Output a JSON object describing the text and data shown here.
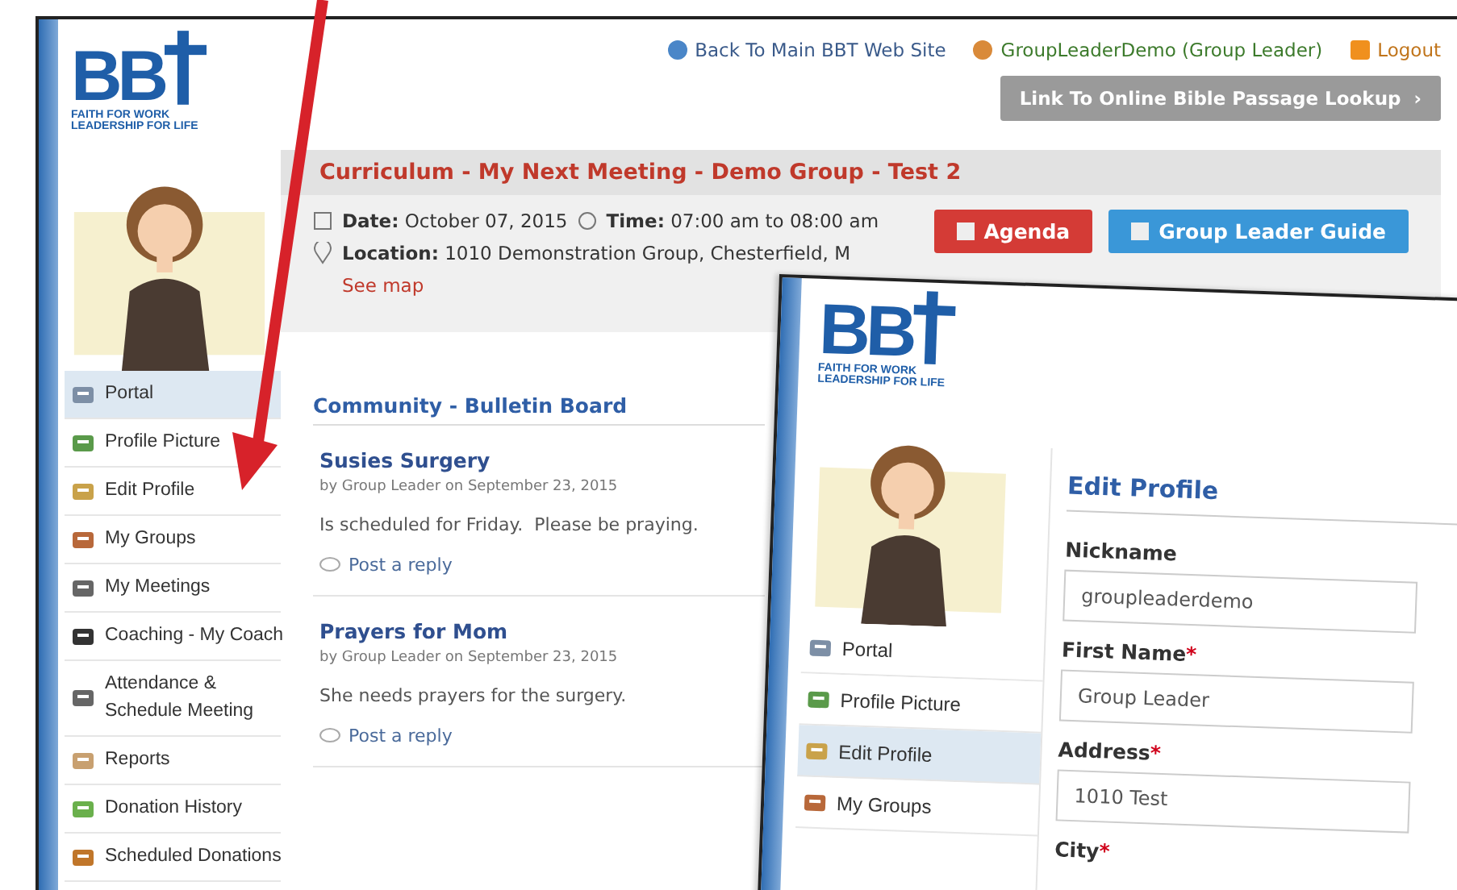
{
  "top_links": [
    {
      "kind": "globe",
      "label": "Back To Main BBT Web Site"
    },
    {
      "kind": "user",
      "label": "GroupLeaderDemo (Group Leader)"
    },
    {
      "kind": "logout",
      "label": "Logout"
    }
  ],
  "lookup_button": {
    "label": "Link To Online Bible Passage Lookup",
    "chevron": "›"
  },
  "logo": {
    "letters": "BB",
    "line1": "FAITH FOR WORK",
    "line2": "LEADERSHIP FOR LIFE"
  },
  "sidebar": {
    "items": [
      {
        "label": "Portal",
        "selected": true
      },
      {
        "label": "Profile Picture",
        "selected": false
      },
      {
        "label": "Edit Profile",
        "selected": false
      },
      {
        "label": "My Groups",
        "selected": false
      },
      {
        "label": "My Meetings",
        "selected": false
      },
      {
        "label": "Coaching - My Coach",
        "selected": false
      },
      {
        "label": "Attendance & Schedule Meeting",
        "selected": false
      },
      {
        "label": "Reports",
        "selected": false
      },
      {
        "label": "Donation History",
        "selected": false
      },
      {
        "label": "Scheduled Donations",
        "selected": false
      }
    ]
  },
  "meeting": {
    "title": "Curriculum - My Next Meeting - Demo Group - Test 2",
    "date": "**Date:** October 07, 2015",
    "time": "**Time:** 07:00 am to 08:00 am",
    "location": "**Location:** 1010 Demonstration Group, Chesterfield, M",
    "map_link": "See map",
    "buttons": [
      {
        "kind": "red",
        "label": "Agenda"
      },
      {
        "kind": "blue",
        "label": "Group Leader Guide"
      }
    ]
  },
  "bulletin": {
    "title": "Community - Bulletin Board",
    "posts": [
      {
        "title": "Susies Surgery",
        "byline": "by Group Leader on September 23, 2015",
        "body": "Is scheduled for Friday.  Please be praying.",
        "reply": "Post a reply"
      },
      {
        "title": "Prayers for Mom",
        "byline": "by Group Leader on September 23, 2015",
        "body": "She needs prayers for the surgery.",
        "reply": "Post a reply"
      }
    ]
  },
  "inset": {
    "logo": {
      "letters": "BB",
      "line1": "FAITH FOR WORK",
      "line2": "LEADERSHIP FOR LIFE"
    },
    "sidebar": {
      "items": [
        {
          "label": "Portal",
          "selected": false
        },
        {
          "label": "Profile Picture",
          "selected": false
        },
        {
          "label": "Edit Profile",
          "selected": true
        },
        {
          "label": "My Groups",
          "selected": false
        }
      ]
    },
    "heading": "Edit Profile",
    "fields": [
      {
        "label": "Nickname",
        "value": "groupleaderdemo"
      },
      {
        "label": "First Name",
        "required_mark": "*",
        "value": "Group Leader"
      },
      {
        "label": "Address",
        "required_mark": "*",
        "value": "1010 Test"
      },
      {
        "label": "City",
        "required_mark": "*"
      }
    ]
  }
}
